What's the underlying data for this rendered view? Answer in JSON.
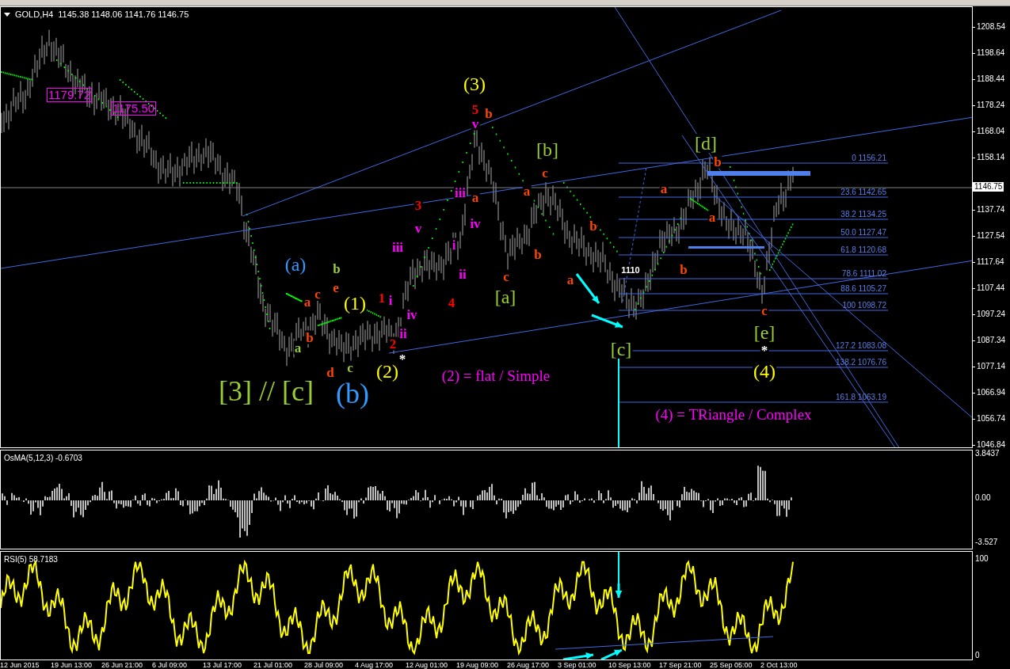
{
  "chart": {
    "symbol": "GOLD,H4",
    "quote": "1145.38 1148.06 1141.76 1146.75"
  },
  "price_axis": [
    "1208.54",
    "1198.64",
    "1188.44",
    "1178.24",
    "1168.04",
    "1158.14",
    "1146.75",
    "1137.74",
    "1127.54",
    "1117.64",
    "1107.44",
    "1097.24",
    "1087.34",
    "1077.14",
    "1066.94",
    "1056.74",
    "1046.84"
  ],
  "price_boxes": [
    "1179.72",
    "1175.50"
  ],
  "fib_levels": [
    "0 1156.21",
    "23.6 1142.65",
    "38.2 1134.25",
    "50.0 1127.47",
    "61.8 1120.68",
    "78.6 1111.02",
    "88.6 1105.27",
    "100 1098.72",
    "127.2 1083.08",
    "138.2 1076.76",
    "161.8 1063.19"
  ],
  "wave_labels": [
    {
      "text": "(3)",
      "color": "#ffff00",
      "kind": "degree"
    },
    {
      "text": "5",
      "color": "#ff0000",
      "kind": "minor"
    },
    {
      "text": "b",
      "color": "#ff4500",
      "kind": "minor"
    },
    {
      "text": "v",
      "color": "#ff00ff",
      "kind": "minor"
    },
    {
      "text": "[b]",
      "color": "#9acd32",
      "kind": "degree"
    },
    {
      "text": "[d]",
      "color": "#9acd32",
      "kind": "degree"
    },
    {
      "text": "c",
      "color": "#ff4500",
      "kind": "minor"
    },
    {
      "text": "b",
      "color": "#ff4500",
      "kind": "minor"
    },
    {
      "text": "iii",
      "color": "#ff00ff",
      "kind": "minor"
    },
    {
      "text": "a",
      "color": "#ff4500",
      "kind": "minor"
    },
    {
      "text": "a",
      "color": "#ff4500",
      "kind": "minor"
    },
    {
      "text": "a",
      "color": "#ff4500",
      "kind": "minor"
    },
    {
      "text": "3",
      "color": "#ff0000",
      "kind": "minor"
    },
    {
      "text": "iv",
      "color": "#ff00ff",
      "kind": "minor"
    },
    {
      "text": "a",
      "color": "#ff4500",
      "kind": "minor"
    },
    {
      "text": "v",
      "color": "#ff00ff",
      "kind": "minor"
    },
    {
      "text": "b",
      "color": "#ff4500",
      "kind": "minor"
    },
    {
      "text": "iii",
      "color": "#ff00ff",
      "kind": "minor"
    },
    {
      "text": "i",
      "color": "#ff00ff",
      "kind": "minor"
    },
    {
      "text": "b",
      "color": "#ff4500",
      "kind": "minor"
    },
    {
      "text": "(a)",
      "color": "#3399ff",
      "kind": "degree"
    },
    {
      "text": "b",
      "color": "#9acd32",
      "kind": "minor"
    },
    {
      "text": "b",
      "color": "#ff4500",
      "kind": "minor"
    },
    {
      "text": "ii",
      "color": "#ff00ff",
      "kind": "minor"
    },
    {
      "text": "c",
      "color": "#ff4500",
      "kind": "minor"
    },
    {
      "text": "e",
      "color": "#ff4500",
      "kind": "minor"
    },
    {
      "text": "a",
      "color": "#ff4500",
      "kind": "minor"
    },
    {
      "text": "c",
      "color": "#ff4500",
      "kind": "minor"
    },
    {
      "text": "a",
      "color": "#ff4500",
      "kind": "minor"
    },
    {
      "text": "(1)",
      "color": "#ffff00",
      "kind": "degree"
    },
    {
      "text": "1",
      "color": "#ff0000",
      "kind": "minor"
    },
    {
      "text": "i",
      "color": "#ff00ff",
      "kind": "minor"
    },
    {
      "text": "4",
      "color": "#ff0000",
      "kind": "minor"
    },
    {
      "text": "[a]",
      "color": "#9acd32",
      "kind": "degree"
    },
    {
      "text": "iv",
      "color": "#ff00ff",
      "kind": "minor"
    },
    {
      "text": "c",
      "color": "#ff4500",
      "kind": "minor"
    },
    {
      "text": "b",
      "color": "#ff4500",
      "kind": "minor"
    },
    {
      "text": "ii",
      "color": "#ff00ff",
      "kind": "minor"
    },
    {
      "text": "[e]",
      "color": "#9acd32",
      "kind": "degree"
    },
    {
      "text": "a",
      "color": "#9acd32",
      "kind": "minor"
    },
    {
      "text": "2",
      "color": "#ff0000",
      "kind": "minor"
    },
    {
      "text": "*",
      "color": "#ffffff",
      "kind": "minor"
    },
    {
      "text": "[c]",
      "color": "#9acd32",
      "kind": "degree"
    },
    {
      "text": "*",
      "color": "#ffffff",
      "kind": "minor"
    },
    {
      "text": "d",
      "color": "#ff4500",
      "kind": "minor"
    },
    {
      "text": "c",
      "color": "#9acd32",
      "kind": "minor"
    },
    {
      "text": "(2)",
      "color": "#ffff00",
      "kind": "degree"
    },
    {
      "text": "(4)",
      "color": "#ffff00",
      "kind": "degree"
    },
    {
      "text": "[3] // [c]",
      "color": "#9acd32",
      "kind": "major"
    },
    {
      "text": "(b)",
      "color": "#3399ff",
      "kind": "major"
    }
  ],
  "notes": [
    {
      "text": "1110",
      "color": "#ffffff",
      "kind": "price"
    },
    {
      "text": "(2) = flat / Simple",
      "color": "#ff00ff",
      "kind": "comment"
    },
    {
      "text": "(4) = TRiangle / Complex",
      "color": "#ff00ff",
      "kind": "comment"
    }
  ],
  "osma": {
    "title": "OsMA(5,12,3) -0.6703",
    "axis": [
      "3.8437",
      "0.00",
      "-3.527"
    ]
  },
  "rsi": {
    "title": "RSI(5) 58.7183",
    "axis": [
      "100",
      "0"
    ]
  },
  "time_axis": [
    "12 Jun 2015",
    "19 Jun 13:00",
    "26 Jun 21:00",
    "6 Jul 09:00",
    "13 Jul 17:00",
    "21 Jul 01:00",
    "28 Jul 09:00",
    "4 Aug 17:00",
    "12 Aug 01:00",
    "19 Aug 09:00",
    "26 Aug 17:00",
    "3 Sep 01:00",
    "10 Sep 13:00",
    "17 Sep 21:00",
    "25 Sep 05:00",
    "2 Oct 13:00"
  ]
}
